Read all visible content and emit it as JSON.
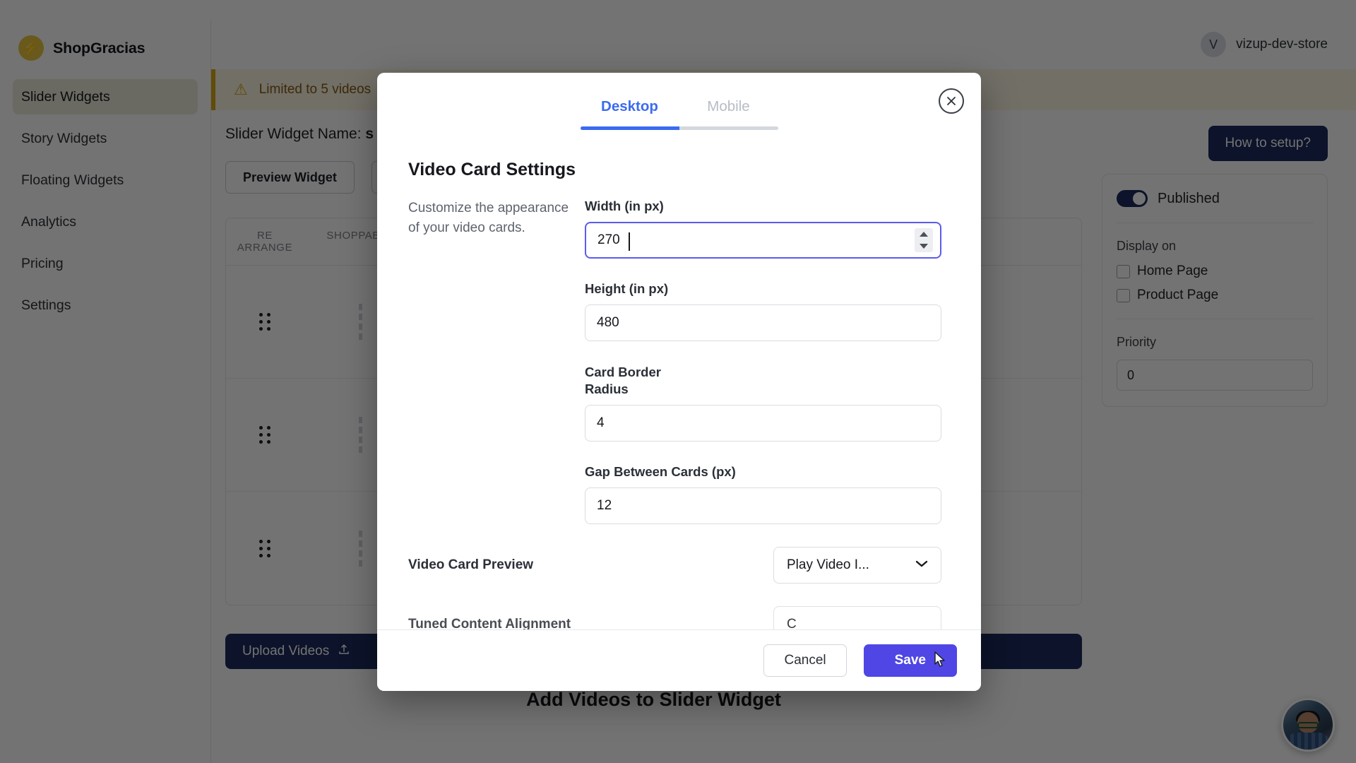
{
  "app": {
    "brand_name": "ShopGracias",
    "brand_icon": "lightning-bolt-icon",
    "store_initial": "V",
    "store_name": "vizup-dev-store"
  },
  "sidebar": {
    "items": [
      {
        "label": "Slider Widgets",
        "active": true
      },
      {
        "label": "Story Widgets",
        "active": false
      },
      {
        "label": "Floating Widgets",
        "active": false
      },
      {
        "label": "Analytics",
        "active": false
      },
      {
        "label": "Pricing",
        "active": false
      },
      {
        "label": "Settings",
        "active": false
      }
    ]
  },
  "banner": {
    "icon": "warning-triangle-icon",
    "text": "Limited to 5 videos"
  },
  "page": {
    "widget_name_prefix": "Slider Widget Name: ",
    "widget_name_value": "s",
    "preview_button": "Preview Widget",
    "how_to_setup_button": "How to setup?",
    "upload_button": "Upload Videos",
    "upload_icon": "upload-arrow-icon",
    "bottom_title": "Add Videos to Slider Widget"
  },
  "video_table": {
    "headers": [
      "RE ARRANGE",
      "SHOPPABLE"
    ],
    "rows": [
      {
        "handle_icon": "drag-handle-icon",
        "thumb": "thumb-a"
      },
      {
        "handle_icon": "drag-handle-icon",
        "thumb": "thumb-b"
      },
      {
        "handle_icon": "drag-handle-icon",
        "thumb": "thumb-c"
      }
    ]
  },
  "right_panel": {
    "published_label": "Published",
    "published_on": true,
    "display_on_label": "Display on",
    "checkboxes": [
      {
        "label": "Home Page",
        "checked": false
      },
      {
        "label": "Product Page",
        "checked": false
      }
    ],
    "priority_label": "Priority",
    "priority_value": "0"
  },
  "modal": {
    "close_icon": "close-circle-icon",
    "tabs": [
      {
        "label": "Desktop",
        "active": true
      },
      {
        "label": "Mobile",
        "active": false
      }
    ],
    "title": "Video Card Settings",
    "description": "Customize the appearance of your video cards.",
    "fields": [
      {
        "label": "Width (in px)",
        "value": "270",
        "focused": true,
        "spinner": true
      },
      {
        "label": "Height (in px)",
        "value": "480",
        "focused": false,
        "spinner": false
      },
      {
        "label": "Card Border Radius",
        "value": "4",
        "focused": false,
        "spinner": false
      },
      {
        "label": "Gap Between Cards (px)",
        "value": "12",
        "focused": false,
        "spinner": false
      }
    ],
    "select_field": {
      "label": "Video Card Preview",
      "value": "Play Video I...",
      "chevron_icon": "chevron-down-icon"
    },
    "cut_off_field": {
      "label": "Tuned Content Alignment",
      "value": "C"
    },
    "cancel_button": "Cancel",
    "save_button": "Save"
  },
  "support": {
    "avatar_icon": "support-avatar-icon"
  },
  "colors": {
    "accent_blue": "#3b6bf0",
    "save_indigo": "#4f46e5",
    "focus_indigo": "#5b5bef",
    "navy": "#1c2b5e",
    "warning_bg": "#fbf6e3",
    "warning_text": "#8a5a12",
    "sidebar_active": "#edecd9"
  }
}
